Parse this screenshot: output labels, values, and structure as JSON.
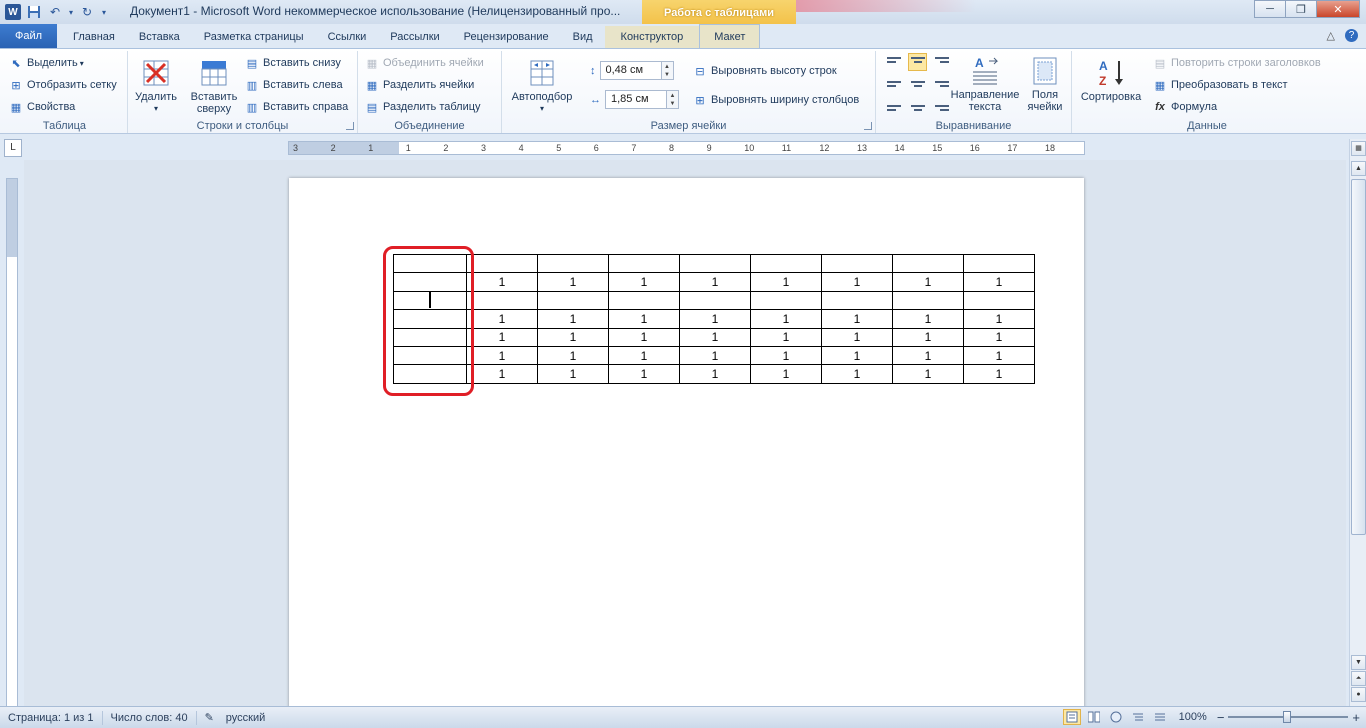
{
  "window": {
    "title": "Документ1 - Microsoft Word некоммерческое использование (Нелицензированный про...",
    "context_group": "Работа с таблицами",
    "minimize": "─",
    "maximize": "❐",
    "close": "✕"
  },
  "tabs": [
    {
      "label": "Файл"
    },
    {
      "label": "Главная"
    },
    {
      "label": "Вставка"
    },
    {
      "label": "Разметка страницы"
    },
    {
      "label": "Ссылки"
    },
    {
      "label": "Рассылки"
    },
    {
      "label": "Рецензирование"
    },
    {
      "label": "Вид"
    },
    {
      "label": "Конструктор"
    },
    {
      "label": "Макет"
    }
  ],
  "tabs_right": {
    "collapse": "△",
    "help": "?"
  },
  "ribbon": {
    "table": {
      "label": "Таблица",
      "select": "Выделить",
      "show_grid": "Отобразить сетку",
      "properties": "Свойства"
    },
    "rows_cols": {
      "label": "Строки и столбцы",
      "delete": "Удалить",
      "insert_above": "Вставить сверху",
      "insert_below": "Вставить снизу",
      "insert_left": "Вставить слева",
      "insert_right": "Вставить справа"
    },
    "merge": {
      "label": "Объединение",
      "merge_cells": "Объединить ячейки",
      "split_cells": "Разделить ячейки",
      "split_table": "Разделить таблицу"
    },
    "cell_size": {
      "label": "Размер ячейки",
      "autofit": "Автоподбор",
      "height": "0,48 см",
      "width": "1,85 см",
      "dist_rows": "Выровнять высоту строк",
      "dist_cols": "Выровнять ширину столбцов"
    },
    "alignment": {
      "label": "Выравнивание",
      "text_direction": "Направление текста",
      "cell_margins": "Поля ячейки"
    },
    "data": {
      "label": "Данные",
      "sort": "Сортировка",
      "repeat_header": "Повторить строки заголовков",
      "convert": "Преобразовать в текст",
      "formula": "Формула"
    }
  },
  "ruler": {
    "corner": "L",
    "marks": [
      "3",
      "2",
      "1",
      "1",
      "2",
      "3",
      "4",
      "5",
      "6",
      "7",
      "8",
      "9",
      "10",
      "11",
      "12",
      "13",
      "14",
      "15",
      "16",
      "17",
      "18"
    ]
  },
  "table": {
    "rows": [
      [
        "",
        "",
        "",
        "",
        "",
        "",
        "",
        "",
        ""
      ],
      [
        "",
        "1",
        "1",
        "1",
        "1",
        "1",
        "1",
        "1",
        "1"
      ],
      [
        "",
        "",
        "",
        "",
        "",
        "",
        "",
        "",
        ""
      ],
      [
        "",
        "1",
        "1",
        "1",
        "1",
        "1",
        "1",
        "1",
        "1"
      ],
      [
        "",
        "1",
        "1",
        "1",
        "1",
        "1",
        "1",
        "1",
        "1"
      ],
      [
        "",
        "1",
        "1",
        "1",
        "1",
        "1",
        "1",
        "1",
        "1"
      ],
      [
        "",
        "1",
        "1",
        "1",
        "1",
        "1",
        "1",
        "1",
        "1"
      ]
    ]
  },
  "status": {
    "page": "Страница: 1 из 1",
    "words": "Число слов: 40",
    "language": "русский",
    "zoom": "100%",
    "zoom_minus": "−",
    "zoom_plus": "+"
  },
  "colors": {
    "accent": "#2b579a",
    "highlight": "#e01e26",
    "context_tab": "#f3c24a"
  }
}
